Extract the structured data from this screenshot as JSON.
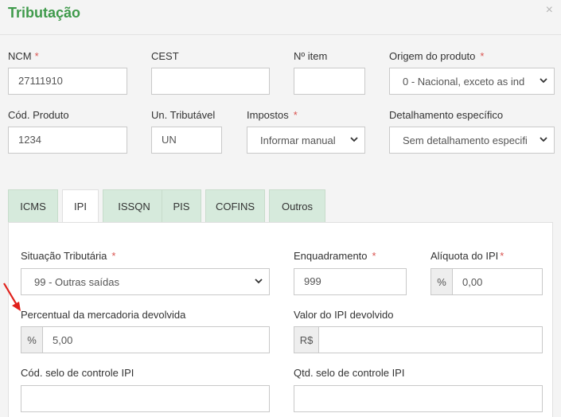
{
  "header": {
    "title": "Tributação",
    "close": "×"
  },
  "form": {
    "ncm": {
      "label": "NCM",
      "required": "*",
      "value": "27111910"
    },
    "cest": {
      "label": "CEST",
      "value": ""
    },
    "n_item": {
      "label": "Nº item",
      "value": ""
    },
    "origem": {
      "label": "Origem do produto",
      "required": "*",
      "value": "0 - Nacional, exceto as ind"
    },
    "cod_produto": {
      "label": "Cód. Produto",
      "value": "1234"
    },
    "un_tributavel": {
      "label": "Un. Tributável",
      "value": "UN"
    },
    "impostos": {
      "label": "Impostos",
      "required": "*",
      "value": "Informar manual"
    },
    "detalhamento": {
      "label": "Detalhamento específico",
      "value": "Sem detalhamento especifi"
    }
  },
  "tabs": [
    {
      "label": "ICMS",
      "active": false
    },
    {
      "label": "IPI",
      "active": true
    },
    {
      "label": "ISSQN",
      "active": false
    },
    {
      "label": "PIS",
      "active": false
    },
    {
      "label": "COFINS",
      "active": false
    },
    {
      "label": "Outros",
      "active": false
    }
  ],
  "ipi": {
    "situacao": {
      "label": "Situação Tributária",
      "required": "*",
      "value": "99 - Outras saídas"
    },
    "enquadramento": {
      "label": "Enquadramento",
      "required": "*",
      "value": "999"
    },
    "aliquota": {
      "label": "Alíquota do IPI",
      "required": "*",
      "addon": "%",
      "value": "0,00"
    },
    "percentual": {
      "label": "Percentual da mercadoria devolvida",
      "addon": "%",
      "value": "5,00"
    },
    "valor_devolvido": {
      "label": "Valor do IPI devolvido",
      "addon": "R$",
      "value": ""
    },
    "cod_selo": {
      "label": "Cód. selo de controle IPI",
      "value": ""
    },
    "qtd_selo": {
      "label": "Qtd. selo de controle IPI",
      "value": ""
    }
  },
  "colors": {
    "accent": "#3f9a4b",
    "tab_bg": "#d6eadc",
    "required": "#d9534f",
    "arrow": "#e0201b"
  },
  "icons": {
    "close": "close-icon",
    "select": "chevron-down-icon",
    "annotation": "red-arrow-icon"
  }
}
